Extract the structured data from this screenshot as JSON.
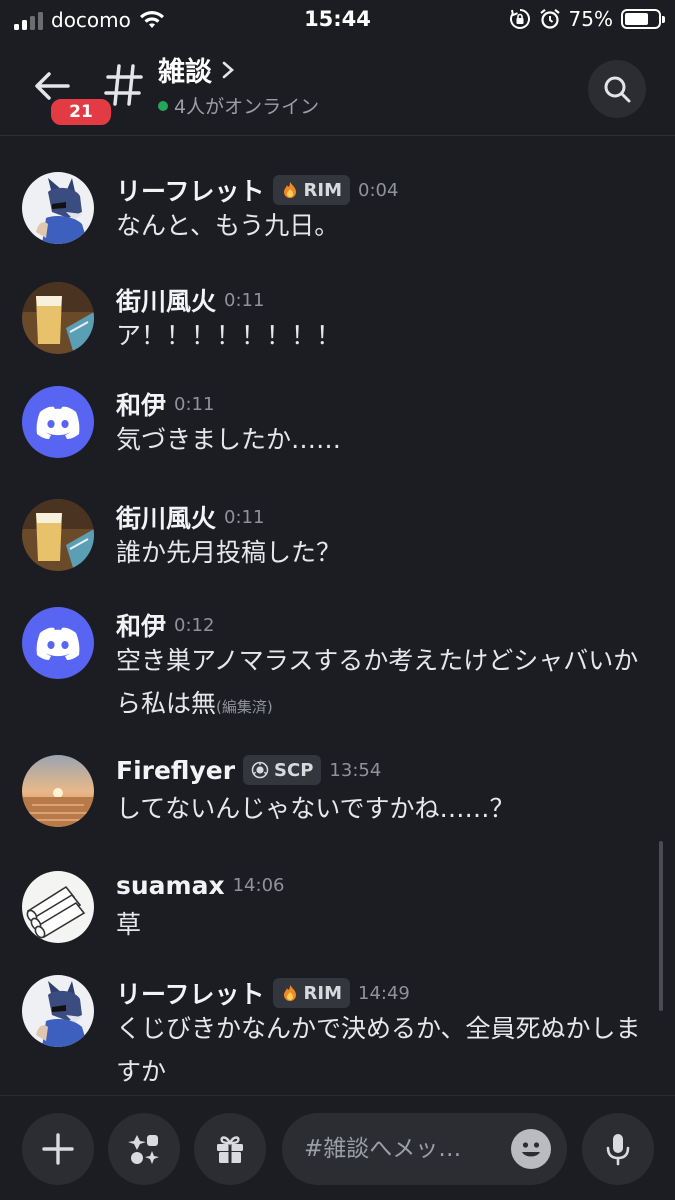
{
  "status_bar": {
    "carrier": "docomo",
    "time": "15:44",
    "battery_percent": "75%",
    "battery_level": 0.75,
    "icons": [
      "signal-icon",
      "wifi-icon",
      "orientation-lock-icon",
      "alarm-icon",
      "battery-icon"
    ]
  },
  "header": {
    "unread_count": "21",
    "channel_name": "雑談",
    "online_text": "4人がオンライン",
    "online_color": "#23a55a"
  },
  "messages": [
    {
      "author": "リーフレット",
      "tag": "RIM",
      "tag_icon": "flame-icon",
      "time": "0:04",
      "text": "なんと、もう九日。",
      "edited": "",
      "avatar": "wolf-avatar"
    },
    {
      "author": "街川風火",
      "tag": "",
      "time": "0:11",
      "text": "ア！！！！！！！！",
      "edited": "",
      "avatar": "drink-photo-avatar"
    },
    {
      "author": "和伊",
      "tag": "",
      "time": "0:11",
      "text": "気づきましたか……",
      "edited": "",
      "avatar": "discord-default-avatar"
    },
    {
      "author": "街川風火",
      "tag": "",
      "time": "0:11",
      "text": "誰か先月投稿した？",
      "edited": "",
      "avatar": "drink-photo-avatar"
    },
    {
      "author": "和伊",
      "tag": "",
      "time": "0:12",
      "text": "空き巣アノマラスするか考えたけどシャバいから私は無",
      "edited": "(編集済)",
      "avatar": "discord-default-avatar"
    },
    {
      "author": "Fireflyer",
      "tag": "SCP",
      "tag_icon": "scp-logo-icon",
      "time": "13:54",
      "text": "してないんじゃないですかね……？",
      "edited": "",
      "avatar": "sunset-photo-avatar"
    },
    {
      "author": "suamax",
      "tag": "",
      "time": "14:06",
      "text": "草",
      "edited": "",
      "avatar": "tubes-drawing-avatar"
    },
    {
      "author": "リーフレット",
      "tag": "RIM",
      "tag_icon": "flame-icon",
      "time": "14:49",
      "text": "くじびきかなんかで決めるか、全員死ぬかしますか",
      "edited": "",
      "avatar": "wolf-avatar"
    }
  ],
  "composer": {
    "placeholder": "#雑談へメッ…",
    "buttons": [
      "plus-icon",
      "apps-icon",
      "gift-icon",
      "emoji-icon",
      "microphone-icon"
    ]
  },
  "colors": {
    "background": "#1c1d22",
    "badge": "#e23b43",
    "blurple": "#5865f2"
  }
}
